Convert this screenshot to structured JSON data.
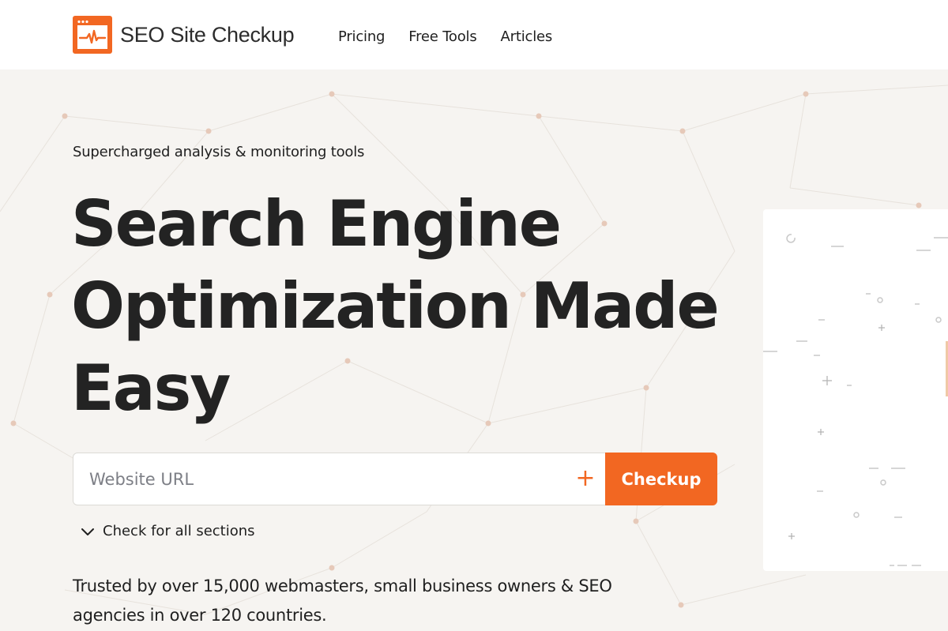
{
  "header": {
    "brand_name": "SEO Site Checkup",
    "nav": [
      {
        "label": "Pricing"
      },
      {
        "label": "Free Tools"
      },
      {
        "label": "Articles"
      }
    ]
  },
  "hero": {
    "tagline": "Supercharged analysis & monitoring tools",
    "headline": "Search Engine Optimization Made Easy",
    "search": {
      "placeholder": "Website URL",
      "value": "",
      "button_label": "Checkup"
    },
    "sections_toggle_label": "Check for all sections",
    "trusted_text": "Trusted by over 15,000 webmasters, small business owners & SEO agencies in over 120 countries."
  },
  "colors": {
    "accent": "#f26722",
    "background": "#f6f4f1",
    "text": "#1f1f1f"
  },
  "icons": {
    "logo": "browser-pulse-icon",
    "add": "plus-icon",
    "toggle": "chevron-down-icon"
  }
}
